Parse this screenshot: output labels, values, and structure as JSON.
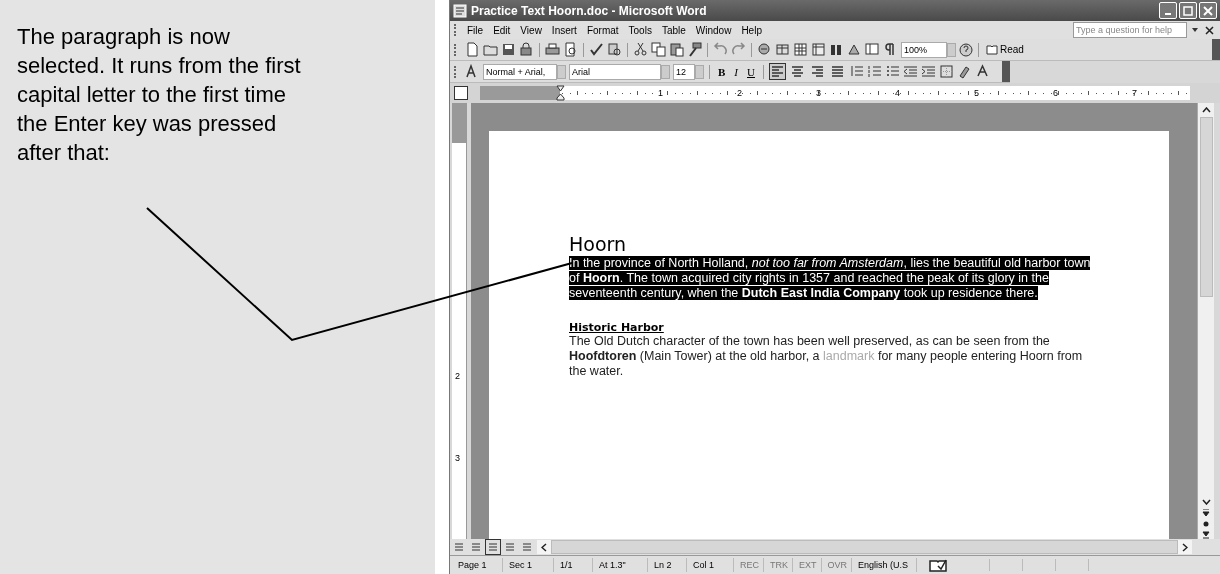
{
  "instructions": {
    "text": "The paragraph is now selected. It runs from the first capital letter to the first time the Enter key was pressed after that:"
  },
  "window": {
    "title": "Practice Text Hoorn.doc - Microsoft Word"
  },
  "menu": [
    "File",
    "Edit",
    "View",
    "Insert",
    "Format",
    "Tools",
    "Table",
    "Window",
    "Help"
  ],
  "help_box": {
    "placeholder": "Type a question for help"
  },
  "standard_toolbar": {
    "zoom": "100%",
    "read_button": "Read"
  },
  "formatting_toolbar": {
    "style": "Normal + Arial,",
    "font": "Arial",
    "size": "12",
    "text_buttons": [
      "B",
      "I",
      "U"
    ],
    "alignments": [
      {
        "selected": true
      },
      {
        "selected": false
      },
      {
        "selected": false
      },
      {
        "selected": false
      }
    ]
  },
  "ruler": {
    "numbers": [
      "1",
      "2",
      "3",
      "4",
      "5",
      "6",
      "7"
    ]
  },
  "vertical_ruler": {
    "numbers": [
      "2",
      "3"
    ]
  },
  "document": {
    "blocks": [
      {
        "kind": "heading",
        "text": "Hoorn"
      },
      {
        "kind": "paragraph",
        "selected": true,
        "segments": [
          {
            "kind": "plain",
            "text": "In the province of North Holland, "
          },
          {
            "kind": "italic",
            "text": "not too far from Amsterdam"
          },
          {
            "kind": "plain",
            "text": ", lies the beautiful old harbor town of "
          },
          {
            "kind": "bold",
            "text": "Hoorn"
          },
          {
            "kind": "plain",
            "text": ". The town acquired city rights in 1357 and reached the peak of its glory in the seventeenth century, when the "
          },
          {
            "kind": "bold",
            "text": "Dutch East India Company"
          },
          {
            "kind": "plain",
            "text": " took up residence there."
          }
        ]
      },
      {
        "kind": "subheading",
        "text": "Historic Harbor"
      },
      {
        "kind": "paragraph",
        "selected": false,
        "segments": [
          {
            "kind": "plain",
            "text": "The Old Dutch character of the town has been well preserved, as can be seen from the "
          },
          {
            "kind": "bold",
            "text": "Hoofdtoren"
          },
          {
            "kind": "plain",
            "text": " (Main Tower) at the old harbor, a "
          },
          {
            "kind": "faint",
            "text": "landmark"
          },
          {
            "kind": "plain",
            "text": " for many people entering Hoorn from the water."
          }
        ]
      }
    ]
  },
  "status_bar": [
    {
      "text": "Page 1",
      "disabled": false
    },
    {
      "text": "Sec 1",
      "disabled": false
    },
    {
      "text": "1/1",
      "disabled": false
    },
    {
      "text": "At 1.3\"",
      "disabled": false
    },
    {
      "text": "Ln 2",
      "disabled": false
    },
    {
      "text": "Col 1",
      "disabled": false
    },
    {
      "text": "REC",
      "disabled": true
    },
    {
      "text": "TRK",
      "disabled": true
    },
    {
      "text": "EXT",
      "disabled": true
    },
    {
      "text": "OVR",
      "disabled": true
    },
    {
      "text": "English (U.S",
      "disabled": false
    }
  ]
}
